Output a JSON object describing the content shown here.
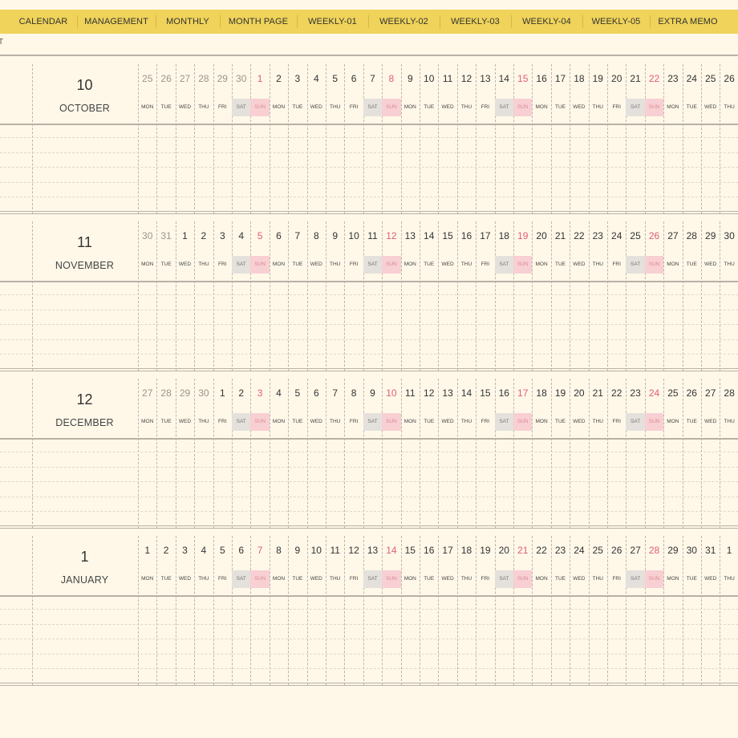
{
  "nav": {
    "tabs": [
      "CALENDAR",
      "MANAGEMENT",
      "MONTHLY",
      "MONTH PAGE",
      "WEEKLY-01",
      "WEEKLY-02",
      "WEEKLY-03",
      "WEEKLY-04",
      "WEEKLY-05",
      "EXTRA MEMO"
    ]
  },
  "edge_char": "T",
  "weekday_labels": [
    "MON",
    "TUE",
    "WED",
    "THU",
    "FRI",
    "SAT",
    "SUN"
  ],
  "colors": {
    "nav_bg": "#efd35a",
    "page_bg": "#fff8e9",
    "sunday": "#e25b78",
    "sat_bg": "#e4e0db",
    "sun_bg": "#f8cfd2"
  },
  "months": [
    {
      "number": "10",
      "name": "OCTOBER",
      "days": [
        "25",
        "26",
        "27",
        "28",
        "29",
        "30",
        "1",
        "2",
        "3",
        "4",
        "5",
        "6",
        "7",
        "8",
        "9",
        "10",
        "11",
        "12",
        "13",
        "14",
        "15",
        "16",
        "17",
        "18",
        "19",
        "20",
        "21",
        "22",
        "23",
        "24",
        "25",
        "26"
      ],
      "other_month_days": [
        0,
        1,
        2,
        3,
        4,
        5
      ]
    },
    {
      "number": "11",
      "name": "NOVEMBER",
      "days": [
        "30",
        "31",
        "1",
        "2",
        "3",
        "4",
        "5",
        "6",
        "7",
        "8",
        "9",
        "10",
        "11",
        "12",
        "13",
        "14",
        "15",
        "16",
        "17",
        "18",
        "19",
        "20",
        "21",
        "22",
        "23",
        "24",
        "25",
        "26",
        "27",
        "28",
        "29",
        "30"
      ],
      "other_month_days": [
        0,
        1
      ]
    },
    {
      "number": "12",
      "name": "DECEMBER",
      "days": [
        "27",
        "28",
        "29",
        "30",
        "1",
        "2",
        "3",
        "4",
        "5",
        "6",
        "7",
        "8",
        "9",
        "10",
        "11",
        "12",
        "13",
        "14",
        "15",
        "16",
        "17",
        "18",
        "19",
        "20",
        "21",
        "22",
        "23",
        "24",
        "25",
        "26",
        "27",
        "28"
      ],
      "other_month_days": [
        0,
        1,
        2,
        3
      ]
    },
    {
      "number": "1",
      "name": "JANUARY",
      "days": [
        "1",
        "2",
        "3",
        "4",
        "5",
        "6",
        "7",
        "8",
        "9",
        "10",
        "11",
        "12",
        "13",
        "14",
        "15",
        "16",
        "17",
        "18",
        "19",
        "20",
        "21",
        "22",
        "23",
        "24",
        "25",
        "26",
        "27",
        "28",
        "29",
        "30",
        "31",
        "1"
      ],
      "other_month_days": []
    }
  ]
}
